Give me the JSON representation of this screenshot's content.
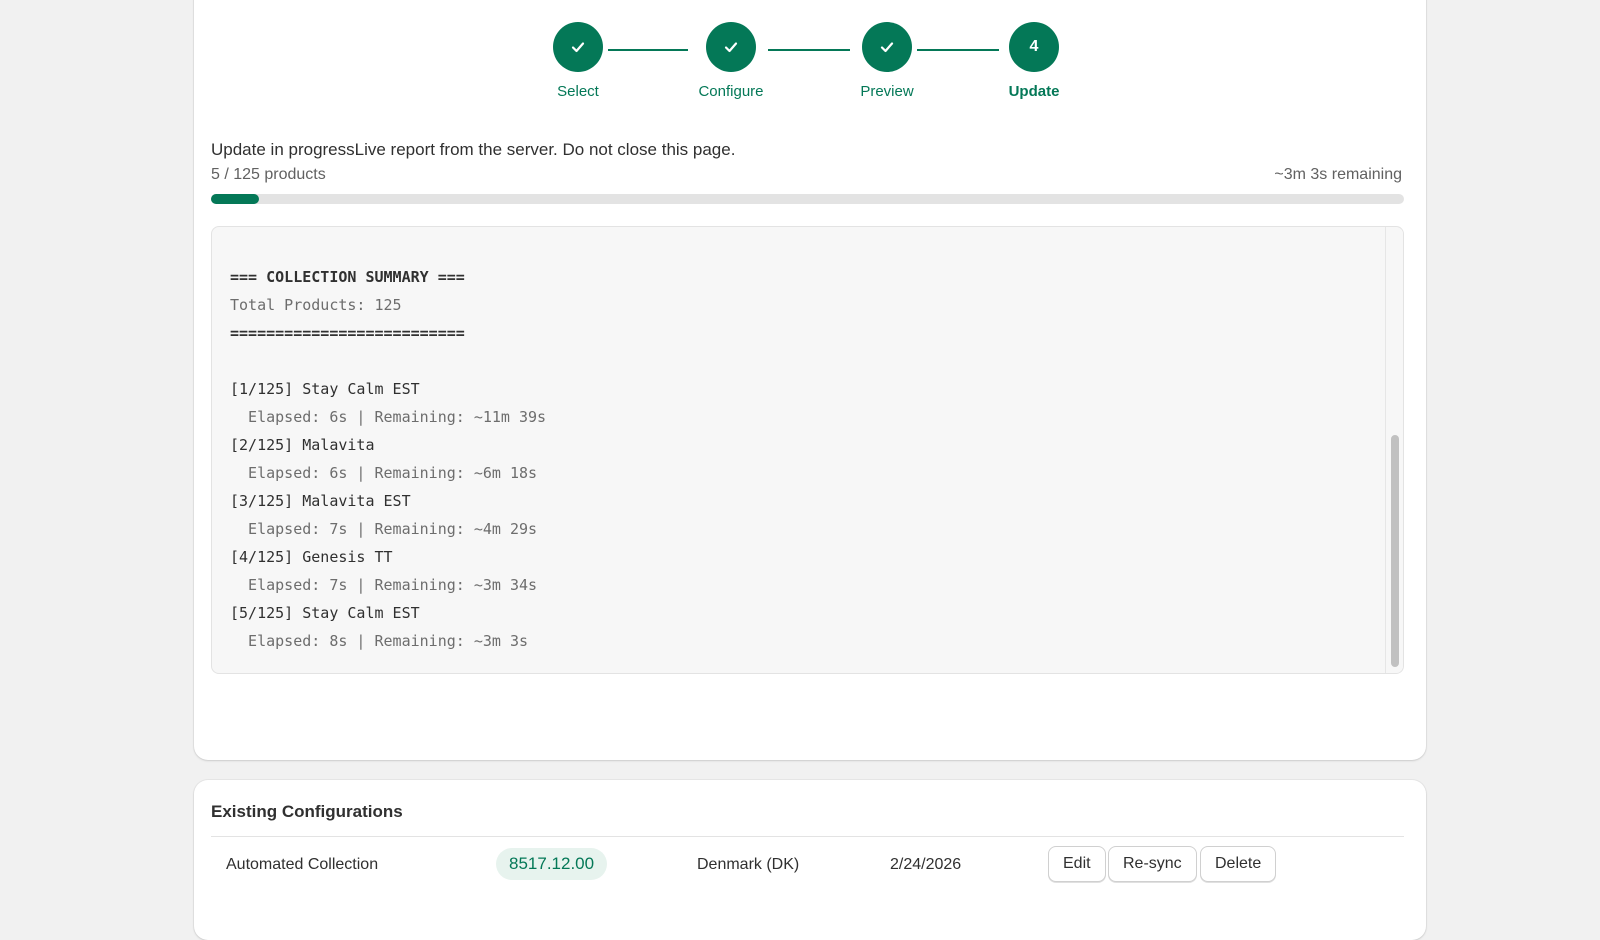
{
  "stepper": {
    "steps": [
      {
        "label": "Select",
        "state": "done",
        "icon": "check-icon"
      },
      {
        "label": "Configure",
        "state": "done",
        "icon": "check-icon"
      },
      {
        "label": "Preview",
        "state": "done",
        "icon": "check-icon"
      },
      {
        "label": "Update",
        "state": "active",
        "number": "4"
      }
    ]
  },
  "progress": {
    "status_text": "Update in progressLive report from the server. Do not close this page.",
    "count_text": "5 / 125 products",
    "remaining_text": "~3m 3s remaining",
    "fraction": 0.04
  },
  "log": {
    "lines": [
      {
        "text": "=== COLLECTION SUMMARY ===",
        "style": "bold"
      },
      {
        "text": "Total Products: 125",
        "style": "muted"
      },
      {
        "text": "==========================",
        "style": "bold"
      },
      {
        "text": "",
        "style": "blank"
      },
      {
        "text": "[1/125] Stay Calm EST",
        "style": "normal"
      },
      {
        "text": "  Elapsed: 6s | Remaining: ~11m 39s",
        "style": "muted"
      },
      {
        "text": "[2/125] Malavita",
        "style": "normal"
      },
      {
        "text": "  Elapsed: 6s | Remaining: ~6m 18s",
        "style": "muted"
      },
      {
        "text": "[3/125] Malavita EST",
        "style": "normal"
      },
      {
        "text": "  Elapsed: 7s | Remaining: ~4m 29s",
        "style": "muted"
      },
      {
        "text": "[4/125] Genesis TT",
        "style": "normal"
      },
      {
        "text": "  Elapsed: 7s | Remaining: ~3m 34s",
        "style": "muted"
      },
      {
        "text": "[5/125] Stay Calm EST",
        "style": "normal"
      },
      {
        "text": "  Elapsed: 8s | Remaining: ~3m 3s",
        "style": "muted"
      }
    ]
  },
  "configs": {
    "title": "Existing Configurations",
    "rows": [
      {
        "name": "Automated Collection",
        "amount": "8517.12.00",
        "market": "Denmark (DK)",
        "date": "2/24/2026",
        "actions": {
          "edit": "Edit",
          "resync": "Re-sync",
          "delete": "Delete"
        }
      }
    ]
  },
  "colors": {
    "accent": "#047857",
    "badge_bg": "#e7f3ee"
  }
}
